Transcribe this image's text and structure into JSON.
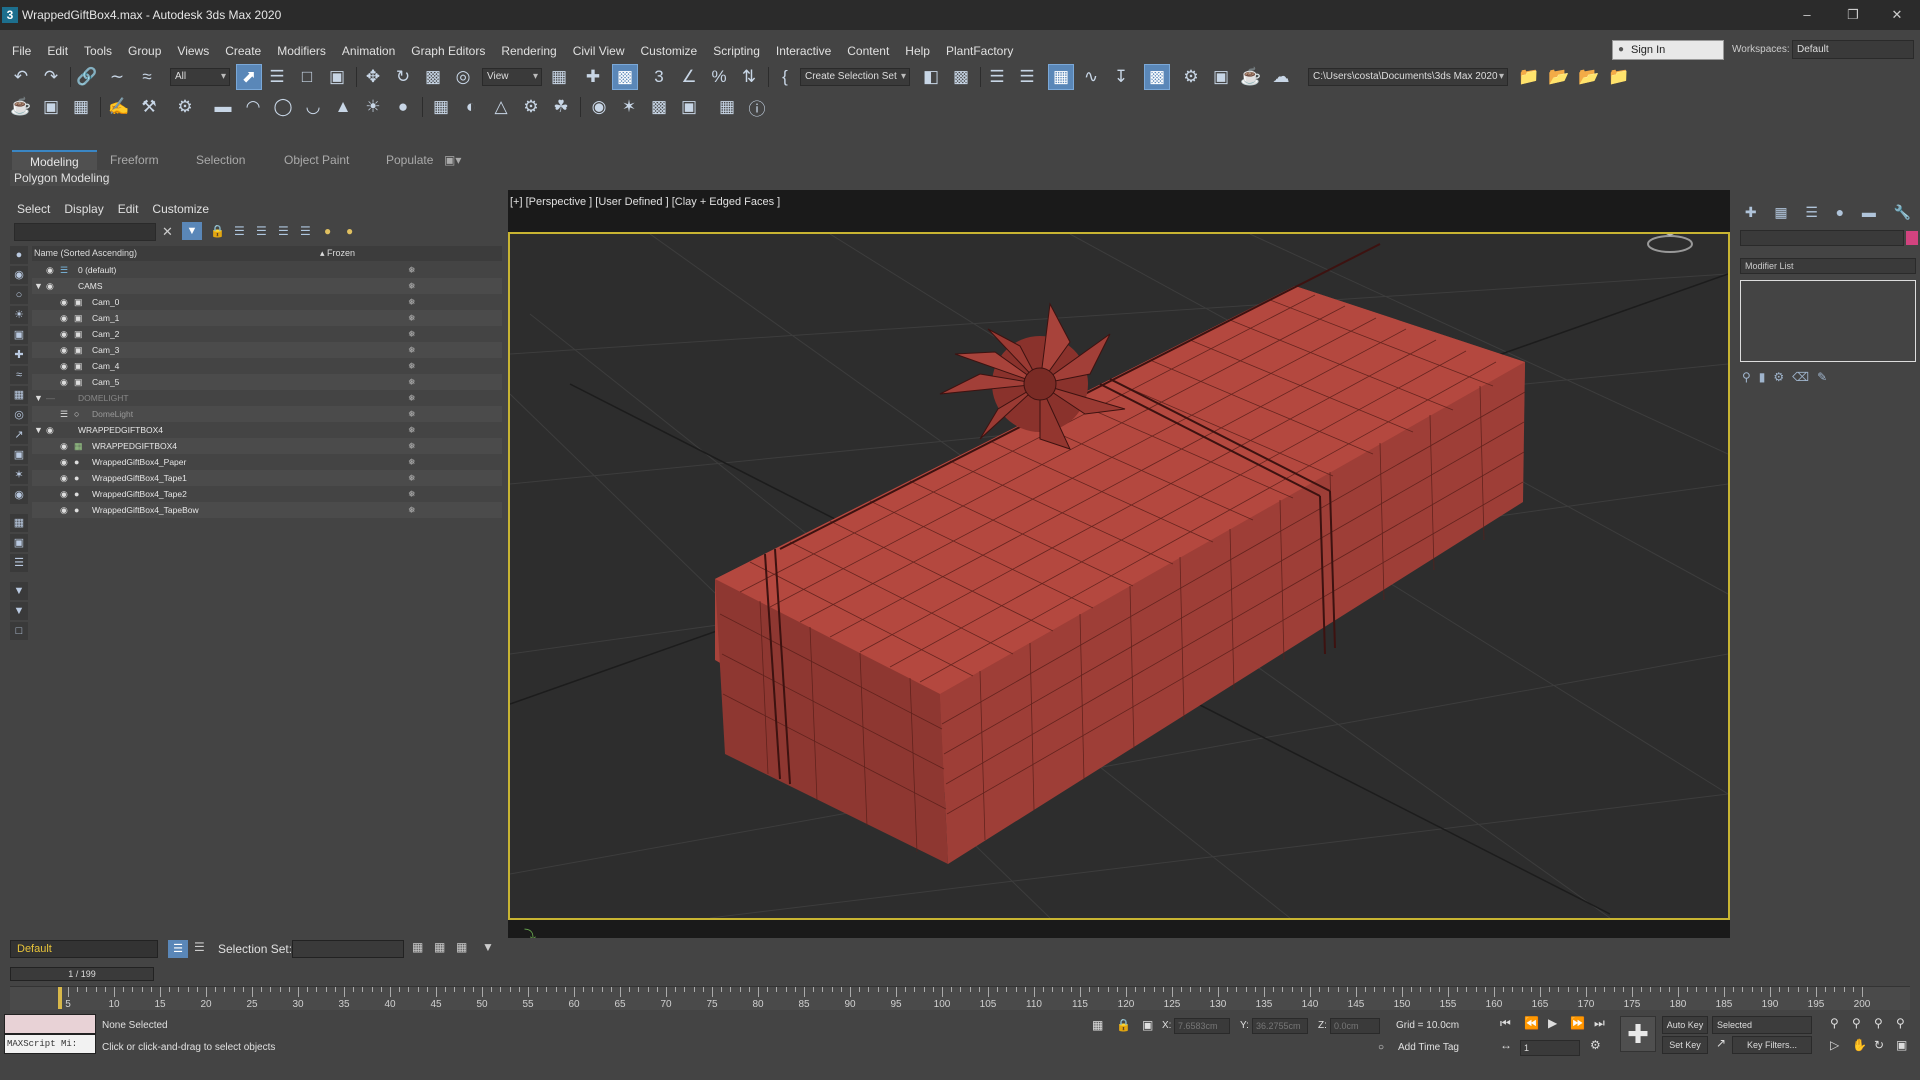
{
  "app": {
    "title": "WrappedGiftBox4.max - Autodesk 3ds Max 2020",
    "icon_label": "3"
  },
  "menu": [
    "File",
    "Edit",
    "Tools",
    "Group",
    "Views",
    "Create",
    "Modifiers",
    "Animation",
    "Graph Editors",
    "Rendering",
    "Civil View",
    "Customize",
    "Scripting",
    "Interactive",
    "Content",
    "Help",
    "PlantFactory"
  ],
  "account": {
    "sign_in": "Sign In",
    "workspaces_label": "Workspaces:",
    "workspace": "Default"
  },
  "toolbar": {
    "selection_filter": "All",
    "ref_coord": "View",
    "selection_set": "Create Selection Set",
    "project_path": "C:\\Users\\costa\\Documents\\3ds Max 2020"
  },
  "ribbon": {
    "tabs": [
      "Modeling",
      "Freeform",
      "Selection",
      "Object Paint",
      "Populate"
    ],
    "panel": "Polygon Modeling"
  },
  "explorer": {
    "menus": [
      "Select",
      "Display",
      "Edit",
      "Customize"
    ],
    "col_name": "Name (Sorted Ascending)",
    "col_frozen": "▴ Frozen",
    "rows": [
      {
        "label": "0 (default)",
        "indent": 0
      },
      {
        "label": "CAMS",
        "indent": 0
      },
      {
        "label": "Cam_0",
        "indent": 1
      },
      {
        "label": "Cam_1",
        "indent": 1
      },
      {
        "label": "Cam_2",
        "indent": 1
      },
      {
        "label": "Cam_3",
        "indent": 1
      },
      {
        "label": "Cam_4",
        "indent": 1
      },
      {
        "label": "Cam_5",
        "indent": 1
      },
      {
        "label": "DOMELIGHT",
        "indent": 0
      },
      {
        "label": "DomeLight",
        "indent": 1
      },
      {
        "label": "WRAPPEDGIFTBOX4",
        "indent": 0
      },
      {
        "label": "WRAPPEDGIFTBOX4",
        "indent": 1
      },
      {
        "label": "WrappedGiftBox4_Paper",
        "indent": 1
      },
      {
        "label": "WrappedGiftBox4_Tape1",
        "indent": 1
      },
      {
        "label": "WrappedGiftBox4_Tape2",
        "indent": 1
      },
      {
        "label": "WrappedGiftBox4_TapeBow",
        "indent": 1
      }
    ]
  },
  "viewport": {
    "label": "[+] [Perspective ] [User Defined ] [Clay + Edged Faces ]"
  },
  "command_panel": {
    "modifier_list": "Modifier List"
  },
  "bottom": {
    "layer": "Default",
    "selection_set_label": "Selection Set:",
    "frame": "1 / 199",
    "ticks": [
      "5",
      "10",
      "15",
      "20",
      "25",
      "30",
      "35",
      "40",
      "45",
      "50",
      "55",
      "60",
      "65",
      "70",
      "75",
      "80",
      "85",
      "90",
      "95",
      "100",
      "105",
      "110",
      "115",
      "120",
      "125",
      "130",
      "135",
      "140",
      "145",
      "150",
      "155",
      "160",
      "165",
      "170",
      "175",
      "180",
      "185",
      "190",
      "195",
      "200"
    ]
  },
  "status": {
    "maxscript": "MAXScript Mi:",
    "selected": "None Selected",
    "prompt": "Click or click-and-drag to select objects",
    "x_label": "X:",
    "x_value": "7.6583cm",
    "y_label": "Y:",
    "y_value": "36.2755cm",
    "z_label": "Z:",
    "z_value": "0.0cm",
    "grid": "Grid = 10.0cm",
    "add_time_tag": "Add Time Tag",
    "frame_field": "1",
    "auto_key": "Auto Key",
    "set_key": "Set Key",
    "key_mode": "Selected",
    "key_filters": "Key Filters..."
  },
  "colors": {
    "box": "#a8433b",
    "box_dark": "#7a2b25",
    "accent": "#c8b432",
    "layer_text": "#e8c43a"
  }
}
